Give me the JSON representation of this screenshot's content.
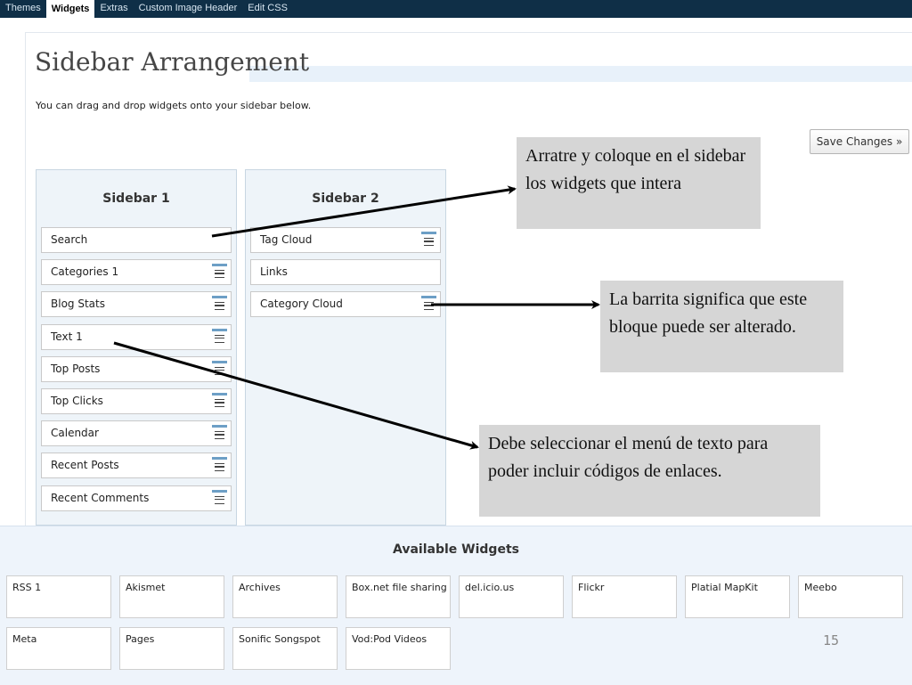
{
  "tabs": [
    {
      "label": "Themes"
    },
    {
      "label": "Widgets",
      "active": true
    },
    {
      "label": "Extras"
    },
    {
      "label": "Custom Image Header"
    },
    {
      "label": "Edit CSS"
    }
  ],
  "page": {
    "title": "Sidebar Arrangement",
    "description": "You can drag and drop widgets onto your sidebar below.",
    "save_label": "Save Changes »"
  },
  "sidebar1": {
    "title": "Sidebar 1",
    "widgets": [
      {
        "label": "Search",
        "handle": false
      },
      {
        "label": "Categories 1",
        "handle": true
      },
      {
        "label": "Blog Stats",
        "handle": true
      },
      {
        "label": "Text 1",
        "handle": true
      },
      {
        "label": "Top Posts",
        "handle": true
      },
      {
        "label": "Top Clicks",
        "handle": true
      },
      {
        "label": "Calendar",
        "handle": true
      },
      {
        "label": "Recent Posts",
        "handle": true
      },
      {
        "label": "Recent Comments",
        "handle": true
      }
    ]
  },
  "sidebar2": {
    "title": "Sidebar 2",
    "widgets": [
      {
        "label": "Tag Cloud",
        "handle": true
      },
      {
        "label": "Links",
        "handle": false
      },
      {
        "label": "Category Cloud",
        "handle": true
      }
    ]
  },
  "available": {
    "title": "Available Widgets",
    "widgets": [
      "RSS 1",
      "Akismet",
      "Archives",
      "Box.net file sharing",
      "del.icio.us",
      "Flickr",
      "Platial MapKit",
      "Meebo",
      "Meta",
      "Pages",
      "Sonific Songspot",
      "Vod:Pod Videos"
    ]
  },
  "callouts": {
    "drag": "Arratre y coloque en el sidebar los widgets que intera",
    "bar": "La barrita significa que este bloque puede ser alterado.",
    "text": "Debe seleccionar el menú de texto para poder incluir códigos de enlaces."
  },
  "page_number": "15",
  "colors": {
    "topbar": "#0f2f47",
    "handle_accent": "#6d9fc6",
    "callout_bg": "#d6d6d6"
  }
}
